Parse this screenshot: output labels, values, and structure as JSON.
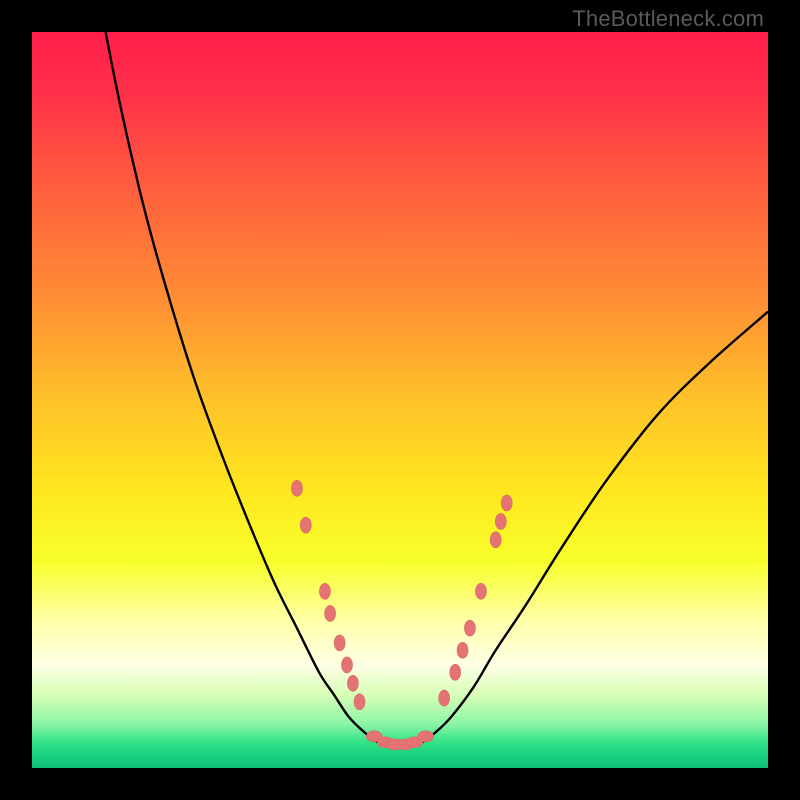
{
  "attribution": "TheBottleneck.com",
  "colors": {
    "frame": "#000000",
    "gradient_stops": [
      {
        "offset": 0.0,
        "color": "#ff1f4b"
      },
      {
        "offset": 0.08,
        "color": "#ff2f49"
      },
      {
        "offset": 0.2,
        "color": "#ff5a3e"
      },
      {
        "offset": 0.35,
        "color": "#ff8a36"
      },
      {
        "offset": 0.5,
        "color": "#ffc22a"
      },
      {
        "offset": 0.62,
        "color": "#ffe61f"
      },
      {
        "offset": 0.72,
        "color": "#f7ff2a"
      },
      {
        "offset": 0.8,
        "color": "#ffffa8"
      },
      {
        "offset": 0.86,
        "color": "#ffffe6"
      },
      {
        "offset": 0.9,
        "color": "#d8ffb8"
      },
      {
        "offset": 0.94,
        "color": "#8cf5a6"
      },
      {
        "offset": 0.965,
        "color": "#34e28a"
      },
      {
        "offset": 0.985,
        "color": "#15cf7e"
      },
      {
        "offset": 1.0,
        "color": "#0fbf74"
      }
    ],
    "curve": "#000000",
    "dot_fill": "#e57373",
    "dot_stroke": "#d86666"
  },
  "chart_data": {
    "type": "line",
    "title": "",
    "xlabel": "",
    "ylabel": "",
    "xlim": [
      0,
      100
    ],
    "ylim": [
      0,
      100
    ],
    "grid": false,
    "legend": false,
    "series": [
      {
        "name": "bottleneck-curve",
        "x": [
          10,
          12,
          15,
          18,
          22,
          26,
          30,
          33,
          36,
          39,
          41,
          43,
          45,
          47,
          49,
          51,
          53,
          55,
          57,
          60,
          63,
          67,
          72,
          78,
          85,
          92,
          100
        ],
        "y": [
          100,
          90,
          77,
          66,
          53,
          42,
          32,
          25,
          19,
          13,
          10,
          7,
          5,
          3.5,
          3,
          3,
          3.5,
          5,
          7,
          11,
          16,
          22,
          30,
          39,
          48,
          55,
          62
        ]
      }
    ],
    "left_dots": [
      {
        "x": 36.0,
        "y": 38.0
      },
      {
        "x": 37.2,
        "y": 33.0
      },
      {
        "x": 39.8,
        "y": 24.0
      },
      {
        "x": 40.5,
        "y": 21.0
      },
      {
        "x": 41.8,
        "y": 17.0
      },
      {
        "x": 42.8,
        "y": 14.0
      },
      {
        "x": 43.6,
        "y": 11.5
      },
      {
        "x": 44.5,
        "y": 9.0
      }
    ],
    "bottom_dots": [
      {
        "x": 46.5,
        "y": 4.3
      },
      {
        "x": 48.0,
        "y": 3.5
      },
      {
        "x": 49.3,
        "y": 3.2
      },
      {
        "x": 50.7,
        "y": 3.2
      },
      {
        "x": 52.0,
        "y": 3.5
      },
      {
        "x": 53.5,
        "y": 4.3
      }
    ],
    "right_dots": [
      {
        "x": 56.0,
        "y": 9.5
      },
      {
        "x": 57.5,
        "y": 13.0
      },
      {
        "x": 58.5,
        "y": 16.0
      },
      {
        "x": 59.5,
        "y": 19.0
      },
      {
        "x": 61.0,
        "y": 24.0
      },
      {
        "x": 63.0,
        "y": 31.0
      },
      {
        "x": 63.7,
        "y": 33.5
      },
      {
        "x": 64.5,
        "y": 36.0
      }
    ]
  }
}
